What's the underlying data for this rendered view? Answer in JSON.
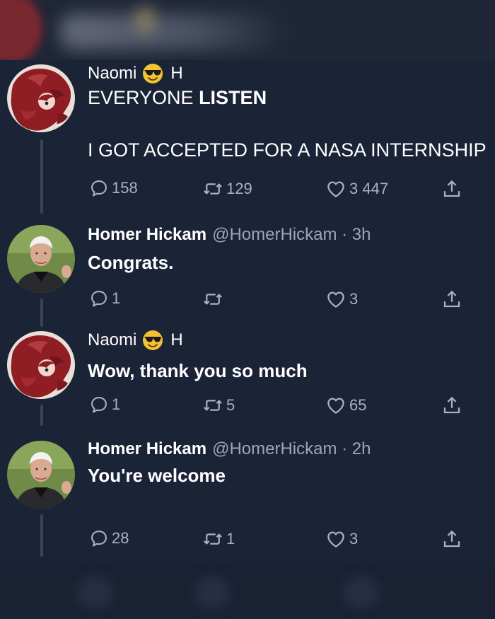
{
  "tweets": [
    {
      "author": "Naomi",
      "author_suffix": "H",
      "emoji": "sunglasses-emoji",
      "line1_normal": "EVERYONE ",
      "line1_bold": "LISTEN",
      "line2": "I GOT ACCEPTED FOR A NASA INTERNSHIP",
      "replies": "158",
      "retweets": "129",
      "likes": "3 447"
    },
    {
      "author": "Homer Hickam",
      "handle": "@HomerHickam · 3h",
      "text": "Congrats.",
      "replies": "1",
      "retweets": "",
      "likes": "3"
    },
    {
      "author": "Naomi",
      "author_suffix": "H",
      "emoji": "sunglasses-emoji",
      "text": "Wow, thank you so much",
      "replies": "1",
      "retweets": "5",
      "likes": "65"
    },
    {
      "author": "Homer Hickam",
      "handle": "@HomerHickam · 2h",
      "text": "You're welcome",
      "replies": "28",
      "retweets": "1",
      "likes": "3"
    }
  ],
  "colors": {
    "background": "#1b2337",
    "text": "#ffffff",
    "muted": "#9ea6b6",
    "icon": "#aab1bf"
  }
}
